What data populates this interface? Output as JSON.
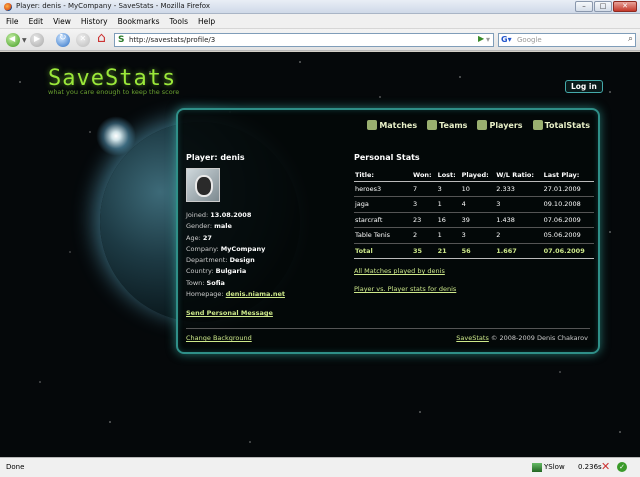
{
  "window": {
    "title": "Player: denis - MyCompany - SaveStats - Mozilla Firefox"
  },
  "menu": [
    "File",
    "Edit",
    "View",
    "History",
    "Bookmarks",
    "Tools",
    "Help"
  ],
  "toolbar": {
    "url": "http://savestats/profile/3",
    "search_placeholder": "Google"
  },
  "site": {
    "logo": "SaveStats",
    "tagline": "what you care enough to keep the score",
    "login": "Log in",
    "nav": [
      "Matches",
      "Teams",
      "Players",
      "TotalStats"
    ]
  },
  "player": {
    "title": "Player: denis",
    "info": [
      {
        "label": "Joined:",
        "value": "13.08.2008"
      },
      {
        "label": "Gender:",
        "value": "male"
      },
      {
        "label": "Age:",
        "value": "27"
      },
      {
        "label": "Company:",
        "value": "MyCompany"
      },
      {
        "label": "Department:",
        "value": "Design"
      },
      {
        "label": "Country:",
        "value": "Bulgaria"
      },
      {
        "label": "Town:",
        "value": "Sofia"
      },
      {
        "label": "Homepage:",
        "value": "denis.niama.net"
      }
    ],
    "send_message": "Send Personal Message"
  },
  "stats": {
    "title": "Personal Stats",
    "headers": [
      "Title:",
      "Won:",
      "Lost:",
      "Played:",
      "W/L Ratio:",
      "Last Play:"
    ],
    "rows": [
      [
        "heroes3",
        "7",
        "3",
        "10",
        "2.333",
        "27.01.2009"
      ],
      [
        "jaga",
        "3",
        "1",
        "4",
        "3",
        "09.10.2008"
      ],
      [
        "starcraft",
        "23",
        "16",
        "39",
        "1.438",
        "07.06.2009"
      ],
      [
        "Table Tenis",
        "2",
        "1",
        "3",
        "2",
        "05.06.2009"
      ]
    ],
    "total": [
      "Total",
      "35",
      "21",
      "56",
      "1.667",
      "07.06.2009"
    ],
    "link_matches": "All Matches played by denis",
    "link_vs": "Player vs. Player stats for denis"
  },
  "footer": {
    "change_bg": "Change Background",
    "brand": "SaveStats",
    "copy": " © 2008-2009 Denis Chakarov"
  },
  "status": {
    "text": "Done",
    "yslow": "YSlow",
    "time": "0.236s"
  }
}
